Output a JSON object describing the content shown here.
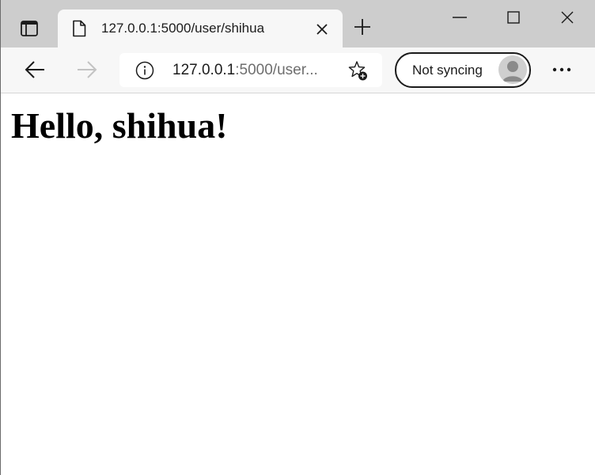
{
  "browser": {
    "tab": {
      "title": "127.0.0.1:5000/user/shihua"
    },
    "address_bar": {
      "host": "127.0.0.1",
      "rest": ":5000/user..."
    },
    "profile": {
      "label": "Not syncing"
    },
    "icons": {
      "tab_actions": "tab-actions-icon",
      "favicon": "page-icon",
      "close_tab": "close-icon",
      "new_tab": "plus-icon",
      "minimize": "minimize-icon",
      "maximize": "maximize-icon",
      "close_window": "close-icon",
      "back": "arrow-left-icon",
      "forward": "arrow-right-icon",
      "site_info": "info-icon",
      "add_favorite": "star-plus-icon",
      "avatar": "avatar-icon",
      "more": "ellipsis-icon"
    },
    "colors": {
      "tabstrip": "#cdcdcd",
      "toolbar": "#f7f7f7",
      "text": "#1b1b1b",
      "muted_text": "#6e6e6e",
      "disabled_icon": "#c3c3c3"
    }
  },
  "page": {
    "heading": "Hello, shihua!"
  }
}
